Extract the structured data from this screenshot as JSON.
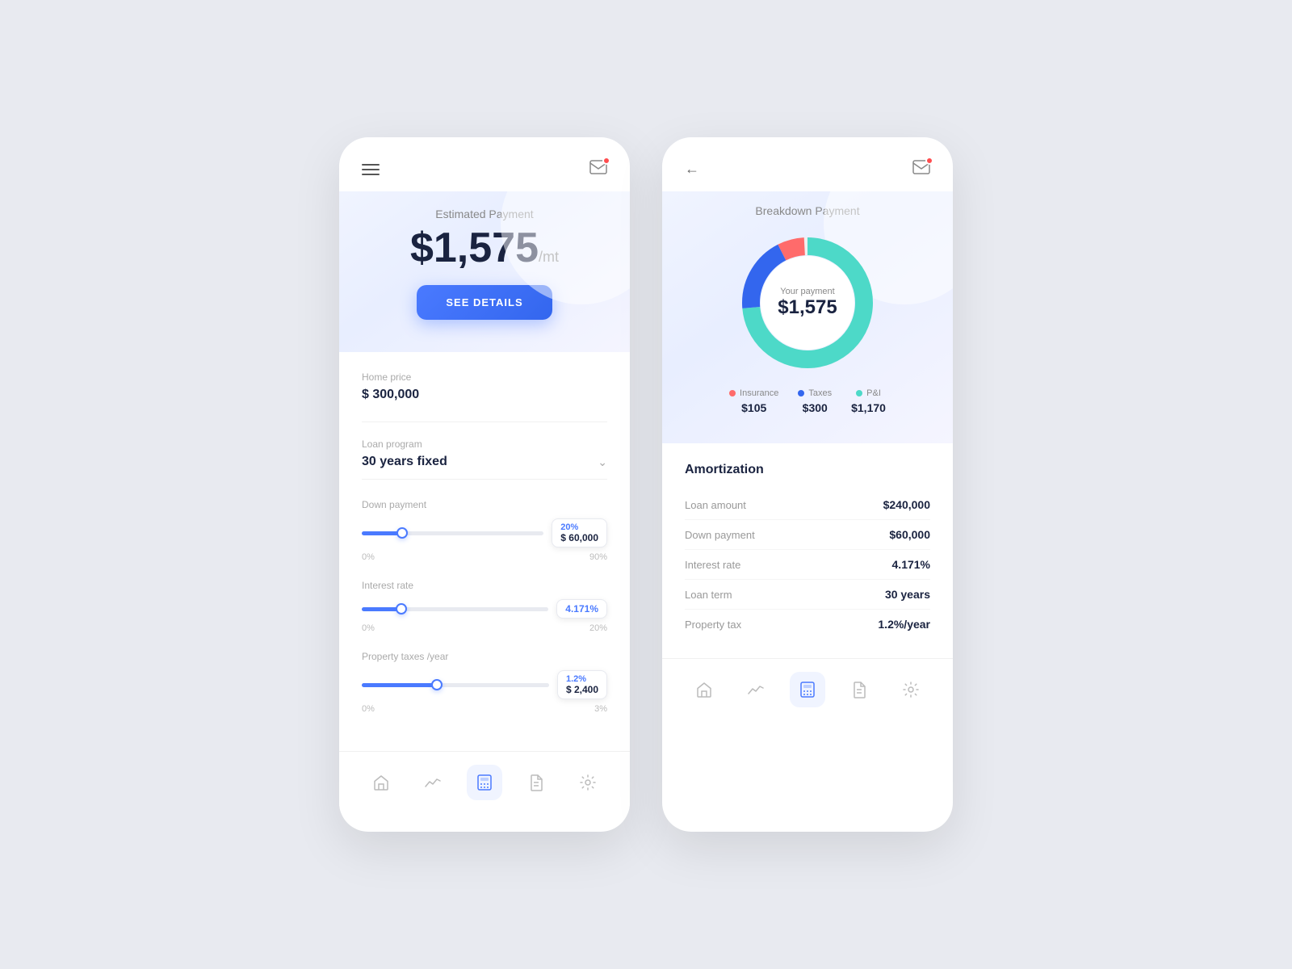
{
  "app": {
    "bg_color": "#e8eaf0",
    "accent_color": "#4a7aff"
  },
  "left_phone": {
    "header": {
      "menu_icon": "≡",
      "mail_icon": "✉"
    },
    "hero": {
      "estimated_label": "Estimated Payment",
      "payment_amount": "$1,575",
      "payment_unit": "/mt",
      "see_details_label": "SEE DETAILS"
    },
    "home_price": {
      "label": "Home price",
      "value": "$ 300,000"
    },
    "loan_program": {
      "label": "Loan program",
      "value": "30 years fixed"
    },
    "down_payment": {
      "label": "Down payment",
      "percent": "20%",
      "amount": "$ 60,000",
      "fill_percent": 22,
      "min_label": "0%",
      "max_label": "90%"
    },
    "interest_rate": {
      "label": "Interest rate",
      "value": "4.171%",
      "fill_percent": 21,
      "min_label": "0%",
      "max_label": "20%"
    },
    "property_taxes": {
      "label": "Property taxes /year",
      "percent": "1.2%",
      "amount": "$ 2,400",
      "fill_percent": 40,
      "min_label": "0%",
      "max_label": "3%"
    },
    "bottom_nav": [
      {
        "icon": "home",
        "active": false
      },
      {
        "icon": "chart",
        "active": false
      },
      {
        "icon": "calculator",
        "active": true
      },
      {
        "icon": "document",
        "active": false
      },
      {
        "icon": "settings",
        "active": false
      }
    ]
  },
  "right_phone": {
    "header": {
      "back_icon": "←",
      "mail_icon": "✉"
    },
    "breakdown": {
      "title": "Breakdown Payment",
      "total_label": "Your payment",
      "total_amount": "$1,575"
    },
    "legend": [
      {
        "color": "#ff6b6b",
        "name": "Insurance",
        "amount": "$105"
      },
      {
        "color": "#4a7aff",
        "name": "Taxes",
        "amount": "$300"
      },
      {
        "color": "#4dd9c8",
        "name": "P&I",
        "amount": "$1,170"
      }
    ],
    "donut": {
      "segments": [
        {
          "label": "Insurance",
          "value": 105,
          "color": "#ff6b6b",
          "pct": 6.67
        },
        {
          "label": "Taxes",
          "value": 300,
          "color": "#3366ee",
          "pct": 19.05
        },
        {
          "label": "P&I",
          "value": 1170,
          "color": "#4dd9c8",
          "pct": 74.28
        }
      ]
    },
    "amortization": {
      "title": "Amortization",
      "rows": [
        {
          "key": "Loan amount",
          "value": "$240,000"
        },
        {
          "key": "Down payment",
          "value": "$60,000"
        },
        {
          "key": "Interest rate",
          "value": "4.171%"
        },
        {
          "key": "Loan term",
          "value": "30 years"
        },
        {
          "key": "Property tax",
          "value": "1.2%/year"
        }
      ]
    },
    "bottom_nav": [
      {
        "icon": "home",
        "active": false
      },
      {
        "icon": "chart",
        "active": false
      },
      {
        "icon": "calculator",
        "active": true
      },
      {
        "icon": "document",
        "active": false
      },
      {
        "icon": "settings",
        "active": false
      }
    ]
  }
}
